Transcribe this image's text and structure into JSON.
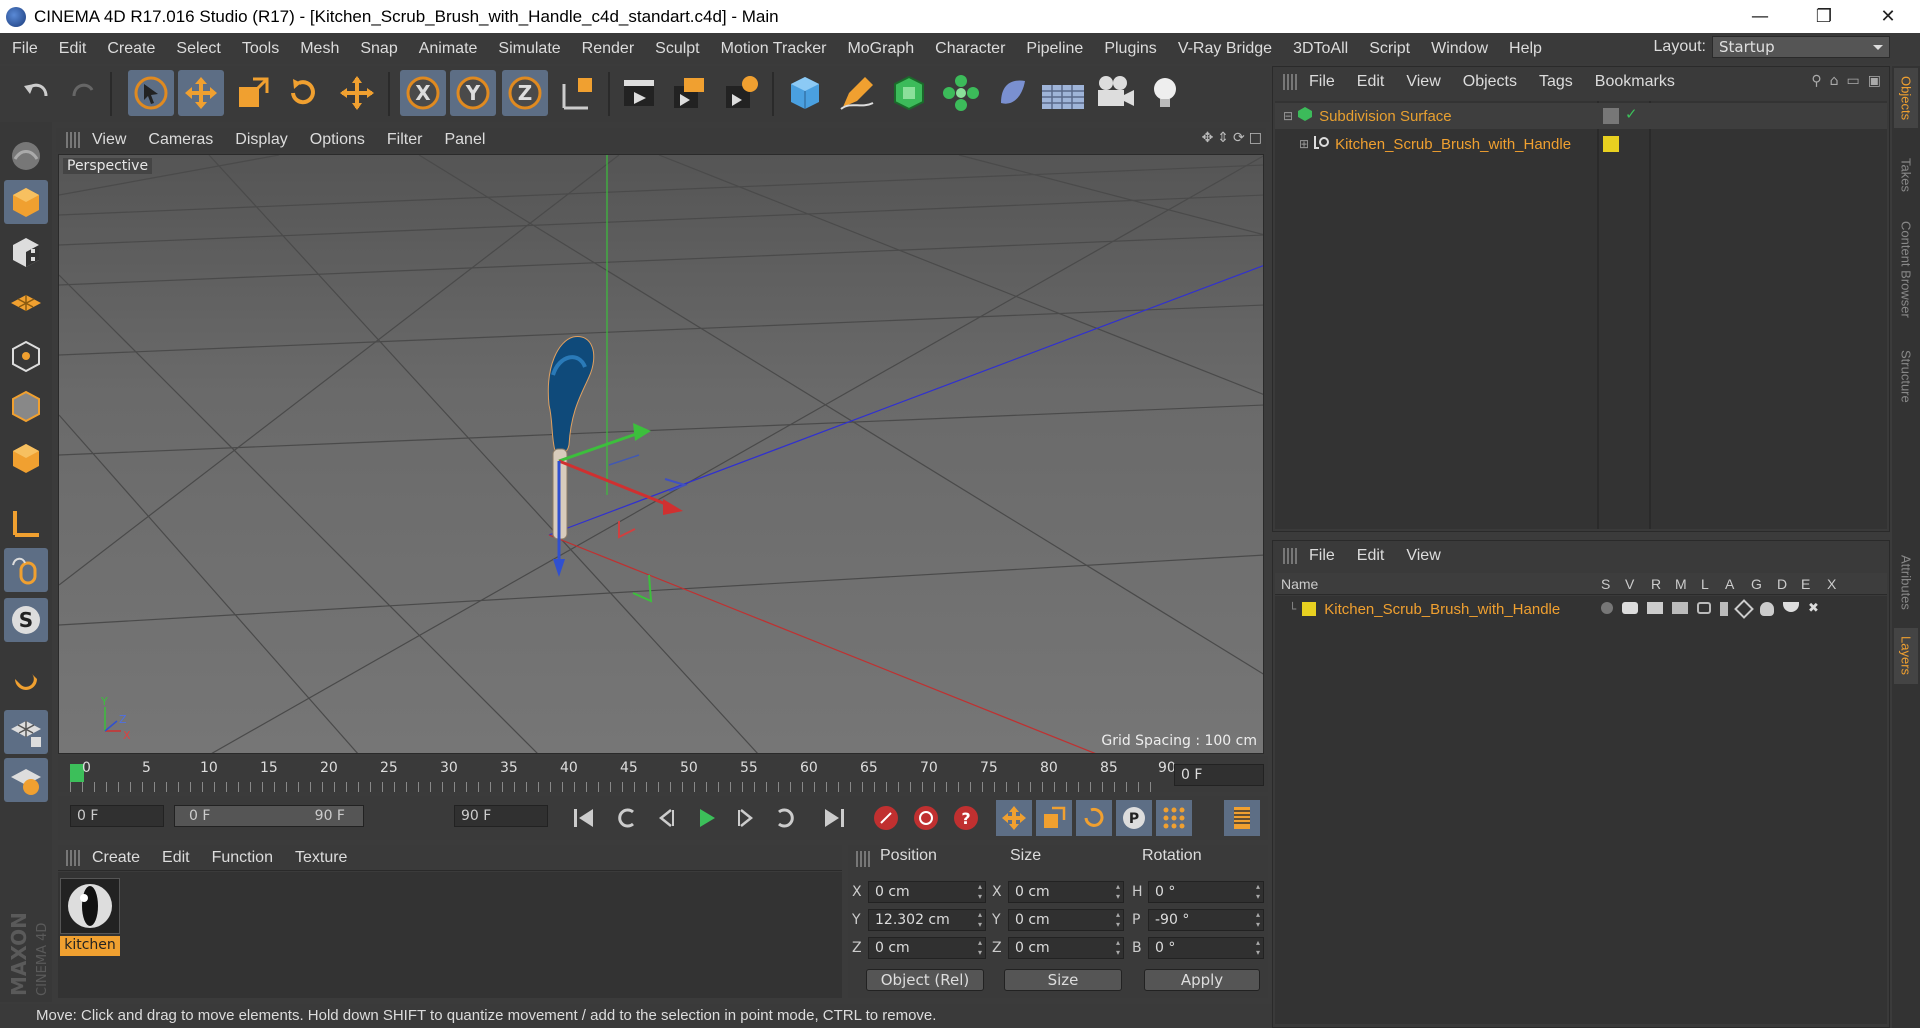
{
  "window": {
    "title": "CINEMA 4D R17.016 Studio (R17) - [Kitchen_Scrub_Brush_with_Handle_c4d_standart.c4d] - Main",
    "buttons": [
      "minimize-icon",
      "restore-icon",
      "close-icon"
    ]
  },
  "menubar": {
    "items": [
      "File",
      "Edit",
      "Create",
      "Select",
      "Tools",
      "Mesh",
      "Snap",
      "Animate",
      "Simulate",
      "Render",
      "Sculpt",
      "Motion Tracker",
      "MoGraph",
      "Character",
      "Pipeline",
      "Plugins",
      "V-Ray Bridge",
      "3DToAll",
      "Script",
      "Window",
      "Help"
    ],
    "layout_label": "Layout:",
    "layout_value": "Startup"
  },
  "toolbar": {
    "icons": [
      "undo-icon",
      "redo-icon",
      "live-selection-icon",
      "move-icon",
      "scale-icon",
      "rotate-icon",
      "recent-tool-icon",
      "x-axis-icon",
      "y-axis-icon",
      "z-axis-icon",
      "coordinate-system-icon",
      "render-view-icon",
      "render-picture-viewer-icon",
      "render-settings-icon",
      "cube-icon",
      "pen-icon",
      "subdivision-icon",
      "array-icon",
      "deformer-icon",
      "floor-icon",
      "camera-icon",
      "light-icon"
    ],
    "axis_labels": [
      "X",
      "Y",
      "Z"
    ]
  },
  "left_tools": {
    "icons": [
      "make-editable-icon",
      "model-mode-icon",
      "texture-mode-icon",
      "workplane-icon",
      "points-mode-icon",
      "edges-mode-icon",
      "polygons-mode-icon",
      "axis-mode-icon",
      "tweak-mode-icon",
      "solo-icon",
      "snap-magnet-icon",
      "workplane-lock-icon",
      "quantize-icon"
    ],
    "solo_letter": "S"
  },
  "viewport": {
    "menu": [
      "View",
      "Cameras",
      "Display",
      "Options",
      "Filter",
      "Panel"
    ],
    "label": "Perspective",
    "grid_spacing": "Grid Spacing : 100 cm",
    "axis_letters": {
      "y": "Y",
      "z": "Z",
      "x": "X"
    },
    "nav_icons": [
      "pan-icon",
      "dolly-icon",
      "rotate-view-icon",
      "maximize-view-icon"
    ]
  },
  "timeline": {
    "ticks": [
      "0",
      "5",
      "10",
      "15",
      "20",
      "25",
      "30",
      "35",
      "40",
      "45",
      "50",
      "55",
      "60",
      "65",
      "70",
      "75",
      "80",
      "85",
      "90"
    ],
    "current_frame": "0 F"
  },
  "transport": {
    "start_field": "0 F",
    "range_start": "0 F",
    "range_end": "90 F",
    "end_field": "90 F",
    "icons": [
      "goto-start-icon",
      "prev-key-icon",
      "prev-frame-icon",
      "play-icon",
      "next-frame-icon",
      "next-key-icon",
      "goto-end-icon",
      "record-icon",
      "autokey-icon",
      "keyframe-selection-icon",
      "move-key-icon",
      "scale-key-icon",
      "rotate-key-icon",
      "param-key-icon",
      "pla-key-icon",
      "timeline-icon"
    ],
    "param_letter": "P"
  },
  "materials": {
    "menu": [
      "Create",
      "Edit",
      "Function",
      "Texture"
    ],
    "items": [
      {
        "name": "kitchen"
      }
    ]
  },
  "coordinates": {
    "headers": [
      "Position",
      "Size",
      "Rotation"
    ],
    "rows": [
      {
        "pos_label": "X",
        "pos": "0 cm",
        "size_label": "X",
        "size": "0 cm",
        "rot_label": "H",
        "rot": "0 °"
      },
      {
        "pos_label": "Y",
        "pos": "12.302 cm",
        "size_label": "Y",
        "size": "0 cm",
        "rot_label": "P",
        "rot": "-90 °"
      },
      {
        "pos_label": "Z",
        "pos": "0 cm",
        "size_label": "Z",
        "size": "0 cm",
        "rot_label": "B",
        "rot": "0 °"
      }
    ],
    "mode": "Object (Rel)",
    "size_mode": "Size",
    "apply": "Apply"
  },
  "objects_panel": {
    "menu": [
      "File",
      "Edit",
      "View",
      "Objects",
      "Tags",
      "Bookmarks"
    ],
    "tree": [
      {
        "name": "Subdivision Surface",
        "icon": "subdivision-surface-icon"
      },
      {
        "name": "Kitchen_Scrub_Brush_with_Handle",
        "icon": "null-object-icon"
      }
    ]
  },
  "layers_panel": {
    "menu": [
      "File",
      "Edit",
      "View"
    ],
    "columns": [
      "Name",
      "S",
      "V",
      "R",
      "M",
      "L",
      "A",
      "G",
      "D",
      "E",
      "X"
    ],
    "layers": [
      {
        "name": "Kitchen_Scrub_Brush_with_Handle",
        "color": "#e8d020"
      }
    ]
  },
  "right_tabs": [
    "Objects",
    "Takes",
    "Content Browser",
    "Structure",
    "Attributes",
    "Layers"
  ],
  "status": "Move: Click and drag to move elements. Hold down SHIFT to quantize movement / add to the selection in point mode, CTRL to remove.",
  "branding": {
    "maxon": "MAXON",
    "cinema": "CINEMA 4D"
  },
  "colors": {
    "accent": "#f0a030",
    "highlight": "#5d6e85",
    "layer_yellow": "#e8d020"
  }
}
